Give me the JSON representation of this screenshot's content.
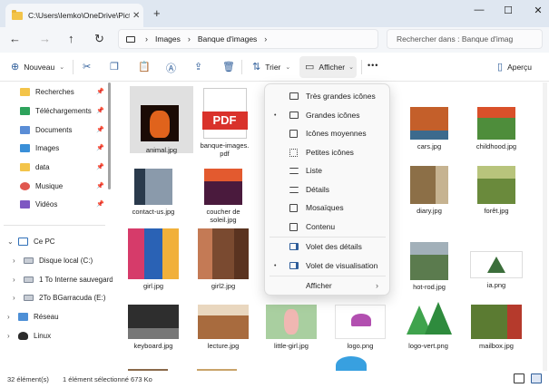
{
  "window": {
    "tab_title": "C:\\Users\\Iemko\\OneDrive\\Pict",
    "tab_close": "✕",
    "new_tab": "+",
    "minimize": "—",
    "maximize": "☐",
    "close": "✕"
  },
  "nav": {
    "back": "←",
    "forward": "→",
    "up": "↑",
    "refresh": "↻",
    "breadcrumb": [
      "Images",
      "Banque d'images"
    ],
    "search_placeholder": "Rechercher dans : Banque d'imag"
  },
  "toolbar": {
    "new_label": "Nouveau",
    "sort_label": "Trier",
    "view_label": "Afficher",
    "more": "•••",
    "preview_label": "Aperçu",
    "icons": [
      "new-icon",
      "cut-icon",
      "copy-icon",
      "paste-icon",
      "rename-icon",
      "share-icon",
      "delete-icon",
      "sort-icon",
      "view-icon",
      "preview-icon"
    ]
  },
  "sidebar": {
    "quick_access": [
      {
        "label": "Recherches",
        "icon": "folder-icon",
        "color": "#f3c44a"
      },
      {
        "label": "Téléchargements",
        "icon": "download-icon",
        "color": "#2ea35c"
      },
      {
        "label": "Documents",
        "icon": "documents-icon",
        "color": "#5a8dd6"
      },
      {
        "label": "Images",
        "icon": "images-icon",
        "color": "#3a8fd8"
      },
      {
        "label": "data",
        "icon": "folder-icon",
        "color": "#f3c44a"
      },
      {
        "label": "Musique",
        "icon": "music-icon",
        "color": "#e0574f"
      },
      {
        "label": "Vidéos",
        "icon": "videos-icon",
        "color": "#7e57c2"
      }
    ],
    "tree": [
      {
        "label": "Ce PC",
        "icon": "pc-icon",
        "expanded": true
      },
      {
        "label": "Disque local (C:)",
        "icon": "drive-icon"
      },
      {
        "label": "1 To Interne sauvegarde",
        "icon": "drive-icon"
      },
      {
        "label": "2To BGarracuda (E:)",
        "icon": "drive-icon"
      },
      {
        "label": "Réseau",
        "icon": "network-icon"
      },
      {
        "label": "Linux",
        "icon": "linux-icon"
      }
    ],
    "pin_glyph": "📌"
  },
  "files": [
    {
      "name": "animal.jpg",
      "selected": true
    },
    {
      "name": "banque-images.\npdf"
    },
    {
      "name": "cars.jpg"
    },
    {
      "name": "childhood.jpg"
    },
    {
      "name": "contact-us.jpg"
    },
    {
      "name": "coucher de\nsoleil.jpg"
    },
    {
      "name": "diary.jpg"
    },
    {
      "name": "forêt.jpg"
    },
    {
      "name": "girl.jpg"
    },
    {
      "name": "girl2.jpg"
    },
    {
      "name": "hot-rod.jpg"
    },
    {
      "name": "ia.png"
    },
    {
      "name": "keyboard.jpg"
    },
    {
      "name": "lecture.jpg"
    },
    {
      "name": "little-girl.jpg"
    },
    {
      "name": "logo.png"
    },
    {
      "name": "logo-vert.png"
    },
    {
      "name": "mailbox.jpg"
    }
  ],
  "view_menu": {
    "items": [
      {
        "label": "Très grandes icônes"
      },
      {
        "label": "Grandes icônes",
        "checked": true
      },
      {
        "label": "Icônes moyennes"
      },
      {
        "label": "Petites icônes"
      },
      {
        "label": "Liste"
      },
      {
        "label": "Détails"
      },
      {
        "label": "Mosaïques"
      },
      {
        "label": "Contenu"
      },
      {
        "label": "Volet des détails"
      },
      {
        "label": "Volet de visualisation",
        "checked": true
      },
      {
        "label": "Afficher",
        "submenu": true
      }
    ],
    "check_glyph": "•",
    "submenu_glyph": "›"
  },
  "status": {
    "count": "32 élément(s)",
    "selection": "1 élément sélectionné  673 Ko"
  },
  "colors": {
    "accent": "#2f5e9a",
    "pdf_red": "#d9322b",
    "selection": "#e0e0e0"
  }
}
